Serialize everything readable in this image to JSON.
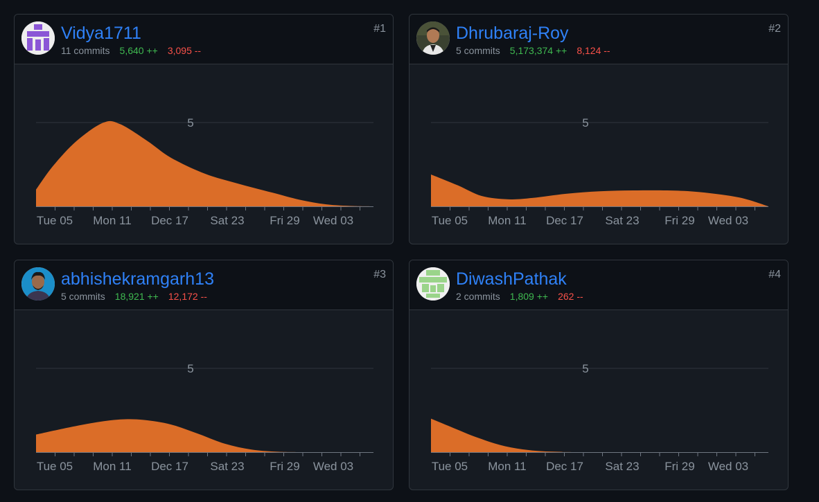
{
  "contributors": [
    {
      "rank": "#1",
      "username": "Vidya1711",
      "commits": "11 commits",
      "additions": "5,640 ++",
      "deletions": "3,095 --",
      "avatar": "identicon-purple",
      "avatar_color": "#8b56d6",
      "chart_data": {
        "type": "area",
        "x_ticks": [
          "Tue 05",
          "Mon 11",
          "Dec 17",
          "Sat 23",
          "Fri 29",
          "Wed 03"
        ],
        "y_ticks": [
          5
        ],
        "ylim": [
          0,
          5
        ],
        "color": "#db6d28",
        "points": [
          [
            0,
            1
          ],
          [
            0.05,
            2.4
          ],
          [
            0.12,
            3.9
          ],
          [
            0.2,
            5
          ],
          [
            0.25,
            4.9
          ],
          [
            0.33,
            3.9
          ],
          [
            0.4,
            2.9
          ],
          [
            0.5,
            1.95
          ],
          [
            0.6,
            1.35
          ],
          [
            0.7,
            0.82
          ],
          [
            0.78,
            0.4
          ],
          [
            0.86,
            0.12
          ],
          [
            0.94,
            0.02
          ],
          [
            1,
            0
          ]
        ]
      }
    },
    {
      "rank": "#2",
      "username": "Dhrubaraj-Roy",
      "commits": "5 commits",
      "additions": "5,173,374 ++",
      "deletions": "8,124 --",
      "avatar": "photo-avatar",
      "avatar_color": "#2f3a2a",
      "chart_data": {
        "type": "area",
        "x_ticks": [
          "Tue 05",
          "Mon 11",
          "Dec 17",
          "Sat 23",
          "Fri 29",
          "Wed 03"
        ],
        "y_ticks": [
          5
        ],
        "ylim": [
          0,
          5
        ],
        "color": "#db6d28",
        "points": [
          [
            0,
            1.9
          ],
          [
            0.08,
            1.25
          ],
          [
            0.15,
            0.62
          ],
          [
            0.23,
            0.42
          ],
          [
            0.3,
            0.5
          ],
          [
            0.4,
            0.75
          ],
          [
            0.5,
            0.9
          ],
          [
            0.6,
            0.95
          ],
          [
            0.7,
            0.95
          ],
          [
            0.78,
            0.88
          ],
          [
            0.86,
            0.7
          ],
          [
            0.93,
            0.45
          ],
          [
            1,
            0
          ]
        ]
      }
    },
    {
      "rank": "#3",
      "username": "abhishekramgarh13",
      "commits": "5 commits",
      "additions": "18,921 ++",
      "deletions": "12,172 --",
      "avatar": "photo-avatar",
      "avatar_color": "#1b8ec9",
      "chart_data": {
        "type": "area",
        "x_ticks": [
          "Tue 05",
          "Mon 11",
          "Dec 17",
          "Sat 23",
          "Fri 29",
          "Wed 03"
        ],
        "y_ticks": [
          5
        ],
        "ylim": [
          0,
          5
        ],
        "color": "#db6d28",
        "points": [
          [
            0,
            1.05
          ],
          [
            0.08,
            1.4
          ],
          [
            0.17,
            1.75
          ],
          [
            0.25,
            1.95
          ],
          [
            0.32,
            1.92
          ],
          [
            0.4,
            1.65
          ],
          [
            0.48,
            1.1
          ],
          [
            0.56,
            0.5
          ],
          [
            0.64,
            0.15
          ],
          [
            0.72,
            0.02
          ],
          [
            0.8,
            0
          ],
          [
            1,
            0
          ]
        ]
      }
    },
    {
      "rank": "#4",
      "username": "DiwashPathak",
      "commits": "2 commits",
      "additions": "1,809 ++",
      "deletions": "262 --",
      "avatar": "identicon-green",
      "avatar_color": "#9ad48a",
      "chart_data": {
        "type": "area",
        "x_ticks": [
          "Tue 05",
          "Mon 11",
          "Dec 17",
          "Sat 23",
          "Fri 29",
          "Wed 03"
        ],
        "y_ticks": [
          5
        ],
        "ylim": [
          0,
          5
        ],
        "color": "#db6d28",
        "points": [
          [
            0,
            2
          ],
          [
            0.06,
            1.5
          ],
          [
            0.14,
            0.85
          ],
          [
            0.22,
            0.35
          ],
          [
            0.3,
            0.1
          ],
          [
            0.38,
            0.02
          ],
          [
            0.46,
            0
          ],
          [
            1,
            0
          ]
        ]
      }
    }
  ]
}
